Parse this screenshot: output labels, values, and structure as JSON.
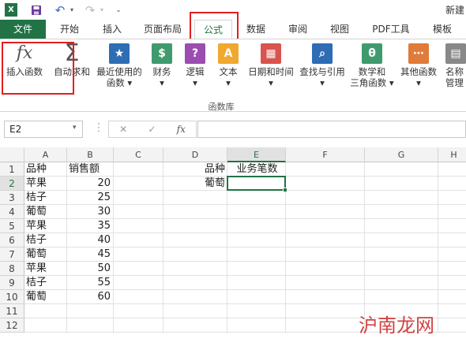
{
  "app": {
    "window_title": "新建"
  },
  "qat": {
    "excel_icon": "excel-logo-icon",
    "save_icon": "save-icon",
    "undo_icon": "undo-icon",
    "redo_icon": "redo-icon",
    "customize_icon": "customize-qat-icon"
  },
  "tabs": [
    "文件",
    "开始",
    "插入",
    "页面布局",
    "公式",
    "数据",
    "审阅",
    "视图",
    "PDF工具",
    "模板"
  ],
  "active_tab": "公式",
  "ribbon": {
    "buttons": [
      {
        "label": "插入函数",
        "icon": "insert-function-icon",
        "glyph": "fx"
      },
      {
        "label": "自动求和",
        "icon": "autosum-icon",
        "glyph": "Σ"
      },
      {
        "label": "最近使用的",
        "label2": "函数 ▾",
        "icon": "recently-used-icon",
        "glyph": "★"
      },
      {
        "label": "财务",
        "label2": "▾",
        "icon": "financial-icon",
        "glyph": "$"
      },
      {
        "label": "逻辑",
        "label2": "▾",
        "icon": "logical-icon",
        "glyph": "?"
      },
      {
        "label": "文本",
        "label2": "▾",
        "icon": "text-icon",
        "glyph": "A"
      },
      {
        "label": "日期和时间",
        "label2": "▾",
        "icon": "datetime-icon",
        "glyph": "▦"
      },
      {
        "label": "查找与引用",
        "label2": "▾",
        "icon": "lookup-icon",
        "glyph": "⌕"
      },
      {
        "label": "数学和",
        "label2": "三角函数 ▾",
        "icon": "math-trig-icon",
        "glyph": "θ"
      },
      {
        "label": "其他函数",
        "label2": "▾",
        "icon": "more-functions-icon",
        "glyph": "⋯"
      },
      {
        "label": "名称",
        "label2": "管理",
        "icon": "name-manager-icon",
        "glyph": "▤"
      }
    ],
    "group_label": "函数库"
  },
  "formula_bar": {
    "name_box": "E2",
    "cancel": "✕",
    "enter": "✓",
    "fx": "fx",
    "content": ""
  },
  "sheet": {
    "columns": [
      "A",
      "B",
      "C",
      "D",
      "E",
      "F",
      "G",
      "H"
    ],
    "rows": [
      "1",
      "2",
      "3",
      "4",
      "5",
      "6",
      "7",
      "8",
      "9",
      "10",
      "11",
      "12"
    ],
    "A": [
      "品种",
      "苹果",
      "桔子",
      "葡萄",
      "苹果",
      "桔子",
      "葡萄",
      "苹果",
      "桔子",
      "葡萄"
    ],
    "B": [
      "销售额",
      "20",
      "25",
      "30",
      "35",
      "40",
      "45",
      "50",
      "55",
      "60"
    ],
    "D": [
      "品种",
      "葡萄"
    ],
    "E": [
      "业务笔数",
      ""
    ]
  },
  "watermark": "沪南龙网",
  "colors": {
    "accent": "#217346",
    "highlight": "#e02020"
  }
}
